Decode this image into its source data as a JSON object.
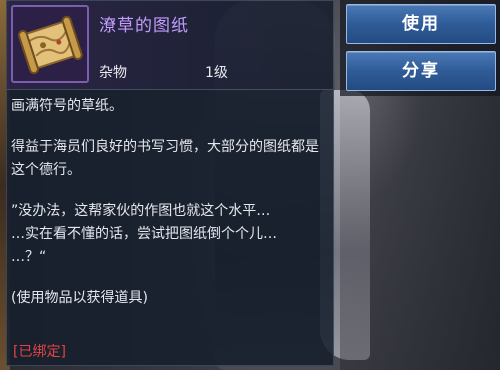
{
  "item": {
    "name": "潦草的图纸",
    "type": "杂物",
    "level": "1级",
    "icon": "scroll-map-icon",
    "rarity_color": "#c29cff"
  },
  "description": {
    "line1": "画满符号的草纸。",
    "line2": "得益于海员们良好的书写习惯，大部分的图纸都是这个德行。",
    "line3": "”没办法，这帮家伙的作图也就这个水平…\n…实在看不懂的话，尝试把图纸倒个个儿…\n…？“",
    "line4": "(使用物品以获得道具)"
  },
  "bound_label": "[已绑定]",
  "actions": {
    "use_label": "使用",
    "share_label": "分享"
  },
  "colors": {
    "bound": "#e04545",
    "button": "#2f5c98"
  }
}
